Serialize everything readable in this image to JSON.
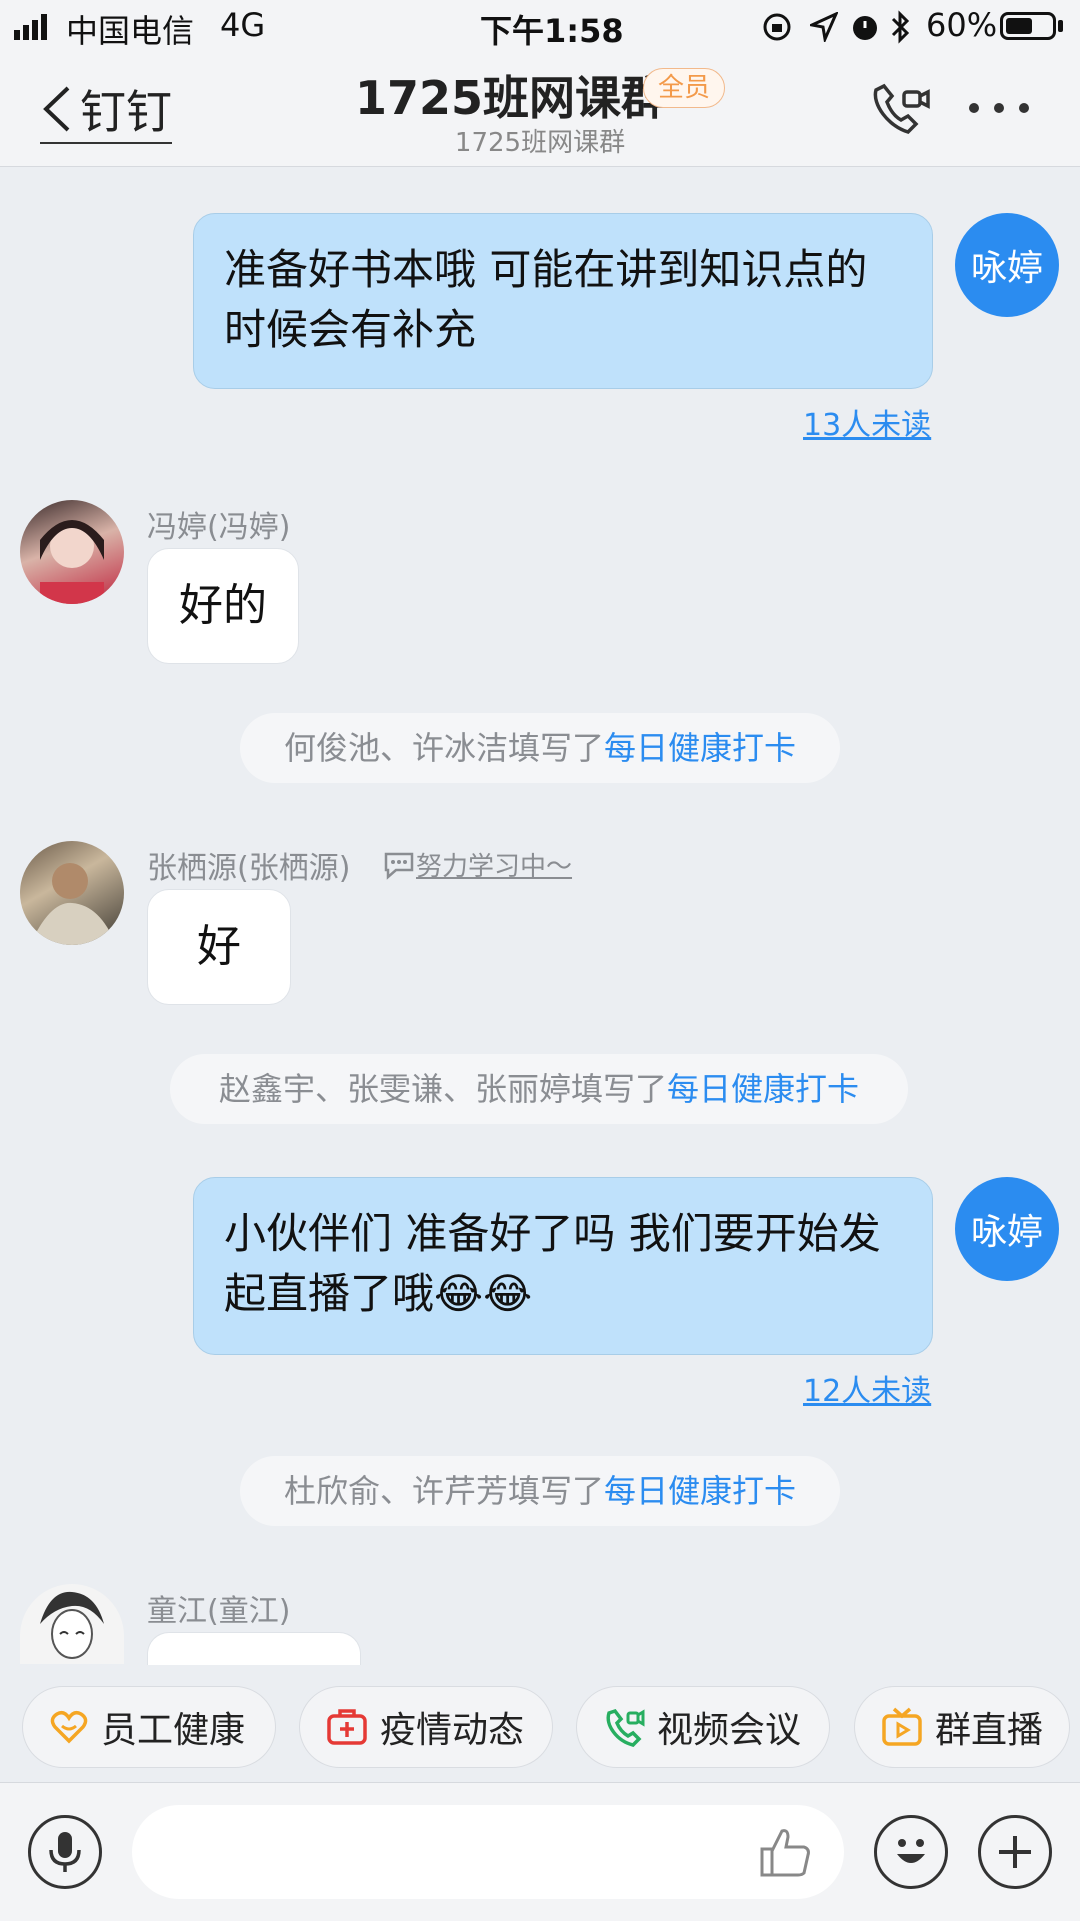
{
  "status_bar": {
    "carrier": "中国电信",
    "network": "4G",
    "time": "下午1:58",
    "battery": "60%",
    "battery_level": 0.6
  },
  "header": {
    "back_label": "钉钉",
    "title": "1725班网课群",
    "badge": "全员",
    "subtitle": "1725班网课群"
  },
  "messages": [
    {
      "sender": "咏婷",
      "text": "准备好书本哦 可能在讲到知识点的时候会有补充",
      "unread": "13人未读"
    },
    {
      "sender": "冯婷(冯婷)",
      "text": "好的"
    },
    {
      "notice_prefix": "何俊池、许冰洁填写了",
      "notice_link": "每日健康打卡"
    },
    {
      "sender": "张栖源(张栖源)",
      "status": "努力学习中～",
      "text": "好"
    },
    {
      "notice_prefix": "赵鑫宇、张雯谦、张丽婷填写了",
      "notice_link": "每日健康打卡"
    },
    {
      "sender": "咏婷",
      "text": "小伙伴们 准备好了吗 我们要开始发起直播了哦😂😂",
      "unread": "12人未读"
    },
    {
      "notice_prefix": "杜欣俞、许芹芳填写了",
      "notice_link": "每日健康打卡"
    },
    {
      "sender": "童江(童江)",
      "text": ""
    }
  ],
  "quick_actions": [
    {
      "label": "员工健康",
      "icon": "heart-icon",
      "color": "#f5a623"
    },
    {
      "label": "疫情动态",
      "icon": "medkit-icon",
      "color": "#e53935"
    },
    {
      "label": "视频会议",
      "icon": "video-call-icon",
      "color": "#27ae60"
    },
    {
      "label": "群直播",
      "icon": "tv-icon",
      "color": "#f5a623"
    }
  ],
  "input": {
    "placeholder": ""
  },
  "colors": {
    "accent": "#2b8cf0",
    "my_bubble": "#bfe1fb"
  }
}
